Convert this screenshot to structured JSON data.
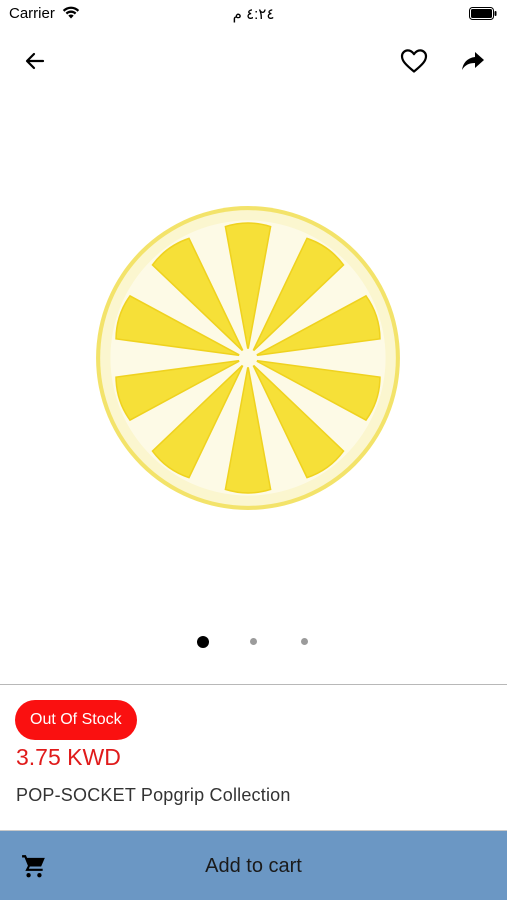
{
  "status_bar": {
    "carrier": "Carrier",
    "time": "٤:٢٤ م"
  },
  "nav": {
    "back_icon": "arrow-left-icon",
    "favorite_icon": "heart-outline-icon",
    "share_icon": "share-arrow-icon"
  },
  "carousel": {
    "image": "lemon-slice",
    "page_count": 3,
    "active_page": 1
  },
  "product": {
    "stock_status": "Out Of Stock",
    "price": "3.75 KWD",
    "name": "POP-SOCKET Popgrip Collection"
  },
  "cart": {
    "icon": "shopping-cart-icon",
    "label": "Add to cart"
  },
  "colors": {
    "stock_badge": "#fa1010",
    "price": "#e01b1b",
    "cart_bar": "#6b97c4"
  }
}
